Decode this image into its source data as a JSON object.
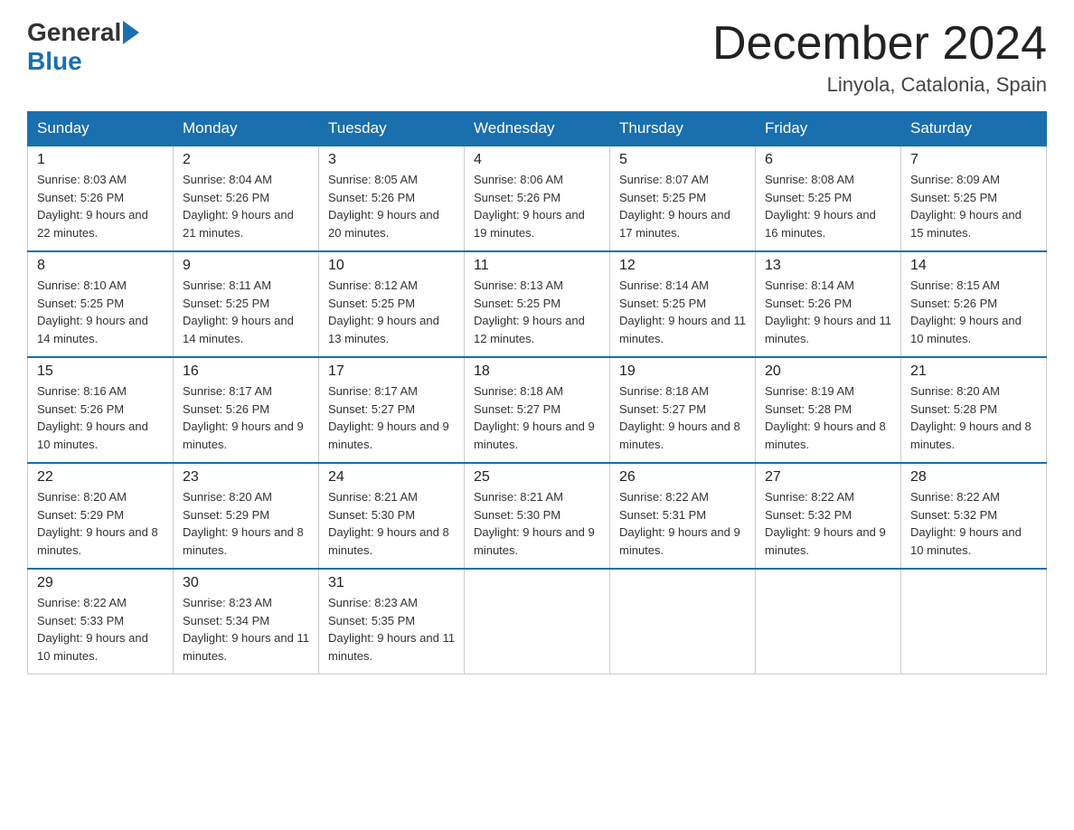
{
  "header": {
    "logo_general": "General",
    "logo_blue": "Blue",
    "month_title": "December 2024",
    "location": "Linyola, Catalonia, Spain"
  },
  "calendar": {
    "weekdays": [
      "Sunday",
      "Monday",
      "Tuesday",
      "Wednesday",
      "Thursday",
      "Friday",
      "Saturday"
    ],
    "weeks": [
      [
        {
          "day": "1",
          "sunrise": "Sunrise: 8:03 AM",
          "sunset": "Sunset: 5:26 PM",
          "daylight": "Daylight: 9 hours and 22 minutes."
        },
        {
          "day": "2",
          "sunrise": "Sunrise: 8:04 AM",
          "sunset": "Sunset: 5:26 PM",
          "daylight": "Daylight: 9 hours and 21 minutes."
        },
        {
          "day": "3",
          "sunrise": "Sunrise: 8:05 AM",
          "sunset": "Sunset: 5:26 PM",
          "daylight": "Daylight: 9 hours and 20 minutes."
        },
        {
          "day": "4",
          "sunrise": "Sunrise: 8:06 AM",
          "sunset": "Sunset: 5:26 PM",
          "daylight": "Daylight: 9 hours and 19 minutes."
        },
        {
          "day": "5",
          "sunrise": "Sunrise: 8:07 AM",
          "sunset": "Sunset: 5:25 PM",
          "daylight": "Daylight: 9 hours and 17 minutes."
        },
        {
          "day": "6",
          "sunrise": "Sunrise: 8:08 AM",
          "sunset": "Sunset: 5:25 PM",
          "daylight": "Daylight: 9 hours and 16 minutes."
        },
        {
          "day": "7",
          "sunrise": "Sunrise: 8:09 AM",
          "sunset": "Sunset: 5:25 PM",
          "daylight": "Daylight: 9 hours and 15 minutes."
        }
      ],
      [
        {
          "day": "8",
          "sunrise": "Sunrise: 8:10 AM",
          "sunset": "Sunset: 5:25 PM",
          "daylight": "Daylight: 9 hours and 14 minutes."
        },
        {
          "day": "9",
          "sunrise": "Sunrise: 8:11 AM",
          "sunset": "Sunset: 5:25 PM",
          "daylight": "Daylight: 9 hours and 14 minutes."
        },
        {
          "day": "10",
          "sunrise": "Sunrise: 8:12 AM",
          "sunset": "Sunset: 5:25 PM",
          "daylight": "Daylight: 9 hours and 13 minutes."
        },
        {
          "day": "11",
          "sunrise": "Sunrise: 8:13 AM",
          "sunset": "Sunset: 5:25 PM",
          "daylight": "Daylight: 9 hours and 12 minutes."
        },
        {
          "day": "12",
          "sunrise": "Sunrise: 8:14 AM",
          "sunset": "Sunset: 5:25 PM",
          "daylight": "Daylight: 9 hours and 11 minutes."
        },
        {
          "day": "13",
          "sunrise": "Sunrise: 8:14 AM",
          "sunset": "Sunset: 5:26 PM",
          "daylight": "Daylight: 9 hours and 11 minutes."
        },
        {
          "day": "14",
          "sunrise": "Sunrise: 8:15 AM",
          "sunset": "Sunset: 5:26 PM",
          "daylight": "Daylight: 9 hours and 10 minutes."
        }
      ],
      [
        {
          "day": "15",
          "sunrise": "Sunrise: 8:16 AM",
          "sunset": "Sunset: 5:26 PM",
          "daylight": "Daylight: 9 hours and 10 minutes."
        },
        {
          "day": "16",
          "sunrise": "Sunrise: 8:17 AM",
          "sunset": "Sunset: 5:26 PM",
          "daylight": "Daylight: 9 hours and 9 minutes."
        },
        {
          "day": "17",
          "sunrise": "Sunrise: 8:17 AM",
          "sunset": "Sunset: 5:27 PM",
          "daylight": "Daylight: 9 hours and 9 minutes."
        },
        {
          "day": "18",
          "sunrise": "Sunrise: 8:18 AM",
          "sunset": "Sunset: 5:27 PM",
          "daylight": "Daylight: 9 hours and 9 minutes."
        },
        {
          "day": "19",
          "sunrise": "Sunrise: 8:18 AM",
          "sunset": "Sunset: 5:27 PM",
          "daylight": "Daylight: 9 hours and 8 minutes."
        },
        {
          "day": "20",
          "sunrise": "Sunrise: 8:19 AM",
          "sunset": "Sunset: 5:28 PM",
          "daylight": "Daylight: 9 hours and 8 minutes."
        },
        {
          "day": "21",
          "sunrise": "Sunrise: 8:20 AM",
          "sunset": "Sunset: 5:28 PM",
          "daylight": "Daylight: 9 hours and 8 minutes."
        }
      ],
      [
        {
          "day": "22",
          "sunrise": "Sunrise: 8:20 AM",
          "sunset": "Sunset: 5:29 PM",
          "daylight": "Daylight: 9 hours and 8 minutes."
        },
        {
          "day": "23",
          "sunrise": "Sunrise: 8:20 AM",
          "sunset": "Sunset: 5:29 PM",
          "daylight": "Daylight: 9 hours and 8 minutes."
        },
        {
          "day": "24",
          "sunrise": "Sunrise: 8:21 AM",
          "sunset": "Sunset: 5:30 PM",
          "daylight": "Daylight: 9 hours and 8 minutes."
        },
        {
          "day": "25",
          "sunrise": "Sunrise: 8:21 AM",
          "sunset": "Sunset: 5:30 PM",
          "daylight": "Daylight: 9 hours and 9 minutes."
        },
        {
          "day": "26",
          "sunrise": "Sunrise: 8:22 AM",
          "sunset": "Sunset: 5:31 PM",
          "daylight": "Daylight: 9 hours and 9 minutes."
        },
        {
          "day": "27",
          "sunrise": "Sunrise: 8:22 AM",
          "sunset": "Sunset: 5:32 PM",
          "daylight": "Daylight: 9 hours and 9 minutes."
        },
        {
          "day": "28",
          "sunrise": "Sunrise: 8:22 AM",
          "sunset": "Sunset: 5:32 PM",
          "daylight": "Daylight: 9 hours and 10 minutes."
        }
      ],
      [
        {
          "day": "29",
          "sunrise": "Sunrise: 8:22 AM",
          "sunset": "Sunset: 5:33 PM",
          "daylight": "Daylight: 9 hours and 10 minutes."
        },
        {
          "day": "30",
          "sunrise": "Sunrise: 8:23 AM",
          "sunset": "Sunset: 5:34 PM",
          "daylight": "Daylight: 9 hours and 11 minutes."
        },
        {
          "day": "31",
          "sunrise": "Sunrise: 8:23 AM",
          "sunset": "Sunset: 5:35 PM",
          "daylight": "Daylight: 9 hours and 11 minutes."
        },
        null,
        null,
        null,
        null
      ]
    ]
  }
}
